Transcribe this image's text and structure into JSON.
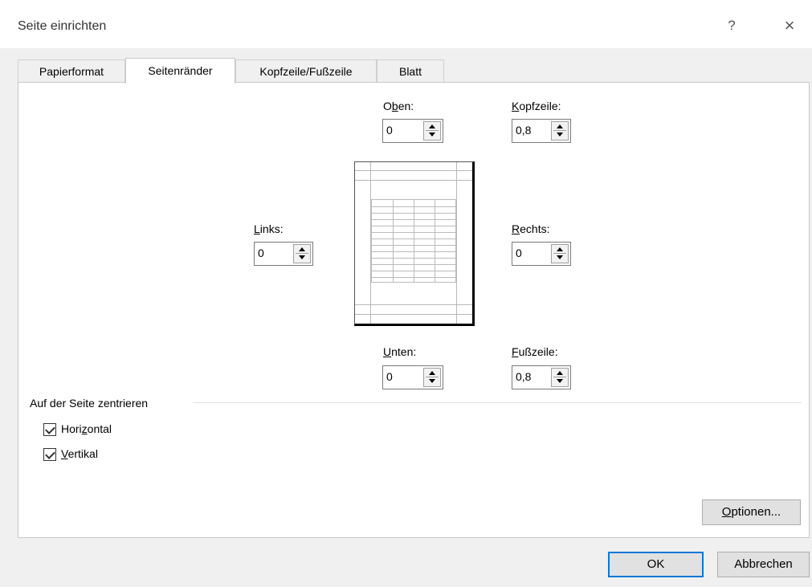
{
  "window": {
    "title": "Seite einrichten",
    "help_label": "?",
    "close_label": "×"
  },
  "tabs": [
    {
      "label": "Papierformat"
    },
    {
      "label": "Seitenränder"
    },
    {
      "label": "Kopfzeile/Fußzeile"
    },
    {
      "label": "Blatt"
    }
  ],
  "margins": {
    "oben": {
      "pre": "O",
      "acc": "b",
      "post": "en:",
      "value": "0"
    },
    "kopfzeile": {
      "pre": "",
      "acc": "K",
      "post": "opfzeile:",
      "value": "0,8"
    },
    "links": {
      "pre": "",
      "acc": "L",
      "post": "inks:",
      "value": "0"
    },
    "rechts": {
      "pre": "",
      "acc": "R",
      "post": "echts:",
      "value": "0"
    },
    "unten": {
      "pre": "",
      "acc": "U",
      "post": "nten:",
      "value": "0"
    },
    "fusszeile": {
      "pre": "",
      "acc": "F",
      "post": "ußzeile:",
      "value": "0,8"
    }
  },
  "center": {
    "heading": "Auf der Seite zentrieren",
    "horizontal": {
      "pre": "Hori",
      "acc": "z",
      "post": "ontal",
      "checked": true
    },
    "vertikal": {
      "pre": "",
      "acc": "V",
      "post": "ertikal",
      "checked": true
    }
  },
  "buttons": {
    "optionen": {
      "pre": "",
      "acc": "O",
      "post": "ptionen..."
    },
    "ok": "OK",
    "abbrechen": "Abbrechen"
  },
  "colors": {
    "accent": "#0078d7",
    "panel": "#ffffff",
    "background": "#f0f0f0"
  }
}
